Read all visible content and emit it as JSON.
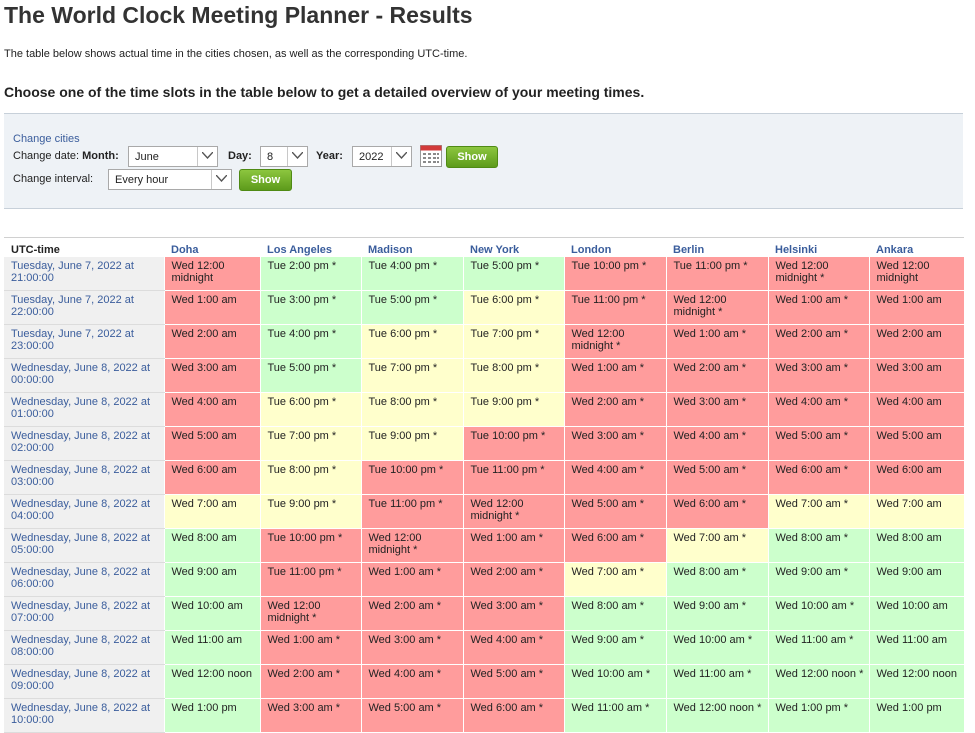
{
  "page": {
    "title": "The World Clock Meeting Planner - Results",
    "intro": "The table below shows actual time in the cities chosen, as well as the corresponding UTC-time.",
    "choose": "Choose one of the time slots in the table below to get a detailed overview of your meeting times."
  },
  "controls": {
    "change_cities": "Change cities",
    "change_date_label": "Change date:",
    "month_label": "Month:",
    "month_value": "June",
    "day_label": "Day:",
    "day_value": "8",
    "year_label": "Year:",
    "year_value": "2022",
    "show_label": "Show",
    "interval_label": "Change interval:",
    "interval_value": "Every hour",
    "show2_label": "Show",
    "calendar_icon": "calendar-icon"
  },
  "table": {
    "headers": [
      "UTC-time",
      "Doha",
      "Los Angeles",
      "Madison",
      "New York",
      "London",
      "Berlin",
      "Helsinki",
      "Ankara"
    ],
    "rows": [
      {
        "utc": "Tuesday, June 7, 2022 at 21:00:00",
        "cells": [
          [
            "Wed 12:00 midnight",
            "r"
          ],
          [
            "Tue 2:00 pm *",
            "g"
          ],
          [
            "Tue 4:00 pm *",
            "g"
          ],
          [
            "Tue 5:00 pm *",
            "g"
          ],
          [
            "Tue 10:00 pm *",
            "r"
          ],
          [
            "Tue 11:00 pm *",
            "r"
          ],
          [
            "Wed 12:00 midnight *",
            "r"
          ],
          [
            "Wed 12:00 midnight",
            "r"
          ]
        ]
      },
      {
        "utc": "Tuesday, June 7, 2022 at 22:00:00",
        "cells": [
          [
            "Wed 1:00 am",
            "r"
          ],
          [
            "Tue 3:00 pm *",
            "g"
          ],
          [
            "Tue 5:00 pm *",
            "g"
          ],
          [
            "Tue 6:00 pm *",
            "y"
          ],
          [
            "Tue 11:00 pm *",
            "r"
          ],
          [
            "Wed 12:00 midnight *",
            "r"
          ],
          [
            "Wed 1:00 am *",
            "r"
          ],
          [
            "Wed 1:00 am",
            "r"
          ]
        ]
      },
      {
        "utc": "Tuesday, June 7, 2022 at 23:00:00",
        "cells": [
          [
            "Wed 2:00 am",
            "r"
          ],
          [
            "Tue 4:00 pm *",
            "g"
          ],
          [
            "Tue 6:00 pm *",
            "y"
          ],
          [
            "Tue 7:00 pm *",
            "y"
          ],
          [
            "Wed 12:00 midnight *",
            "r"
          ],
          [
            "Wed 1:00 am *",
            "r"
          ],
          [
            "Wed 2:00 am *",
            "r"
          ],
          [
            "Wed 2:00 am",
            "r"
          ]
        ]
      },
      {
        "utc": "Wednesday, June 8, 2022 at 00:00:00",
        "cells": [
          [
            "Wed 3:00 am",
            "r"
          ],
          [
            "Tue 5:00 pm *",
            "g"
          ],
          [
            "Tue 7:00 pm *",
            "y"
          ],
          [
            "Tue 8:00 pm *",
            "y"
          ],
          [
            "Wed 1:00 am *",
            "r"
          ],
          [
            "Wed 2:00 am *",
            "r"
          ],
          [
            "Wed 3:00 am *",
            "r"
          ],
          [
            "Wed 3:00 am",
            "r"
          ]
        ]
      },
      {
        "utc": "Wednesday, June 8, 2022 at 01:00:00",
        "cells": [
          [
            "Wed 4:00 am",
            "r"
          ],
          [
            "Tue 6:00 pm *",
            "y"
          ],
          [
            "Tue 8:00 pm *",
            "y"
          ],
          [
            "Tue 9:00 pm *",
            "y"
          ],
          [
            "Wed 2:00 am *",
            "r"
          ],
          [
            "Wed 3:00 am *",
            "r"
          ],
          [
            "Wed 4:00 am *",
            "r"
          ],
          [
            "Wed 4:00 am",
            "r"
          ]
        ]
      },
      {
        "utc": "Wednesday, June 8, 2022 at 02:00:00",
        "cells": [
          [
            "Wed 5:00 am",
            "r"
          ],
          [
            "Tue 7:00 pm *",
            "y"
          ],
          [
            "Tue 9:00 pm *",
            "y"
          ],
          [
            "Tue 10:00 pm *",
            "r"
          ],
          [
            "Wed 3:00 am *",
            "r"
          ],
          [
            "Wed 4:00 am *",
            "r"
          ],
          [
            "Wed 5:00 am *",
            "r"
          ],
          [
            "Wed 5:00 am",
            "r"
          ]
        ]
      },
      {
        "utc": "Wednesday, June 8, 2022 at 03:00:00",
        "cells": [
          [
            "Wed 6:00 am",
            "r"
          ],
          [
            "Tue 8:00 pm *",
            "y"
          ],
          [
            "Tue 10:00 pm *",
            "r"
          ],
          [
            "Tue 11:00 pm *",
            "r"
          ],
          [
            "Wed 4:00 am *",
            "r"
          ],
          [
            "Wed 5:00 am *",
            "r"
          ],
          [
            "Wed 6:00 am *",
            "r"
          ],
          [
            "Wed 6:00 am",
            "r"
          ]
        ]
      },
      {
        "utc": "Wednesday, June 8, 2022 at 04:00:00",
        "cells": [
          [
            "Wed 7:00 am",
            "y"
          ],
          [
            "Tue 9:00 pm *",
            "y"
          ],
          [
            "Tue 11:00 pm *",
            "r"
          ],
          [
            "Wed 12:00 midnight *",
            "r"
          ],
          [
            "Wed 5:00 am *",
            "r"
          ],
          [
            "Wed 6:00 am *",
            "r"
          ],
          [
            "Wed 7:00 am *",
            "y"
          ],
          [
            "Wed 7:00 am",
            "y"
          ]
        ]
      },
      {
        "utc": "Wednesday, June 8, 2022 at 05:00:00",
        "cells": [
          [
            "Wed 8:00 am",
            "g"
          ],
          [
            "Tue 10:00 pm *",
            "r"
          ],
          [
            "Wed 12:00 midnight *",
            "r"
          ],
          [
            "Wed 1:00 am *",
            "r"
          ],
          [
            "Wed 6:00 am *",
            "r"
          ],
          [
            "Wed 7:00 am *",
            "y"
          ],
          [
            "Wed 8:00 am *",
            "g"
          ],
          [
            "Wed 8:00 am",
            "g"
          ]
        ]
      },
      {
        "utc": "Wednesday, June 8, 2022 at 06:00:00",
        "cells": [
          [
            "Wed 9:00 am",
            "g"
          ],
          [
            "Tue 11:00 pm *",
            "r"
          ],
          [
            "Wed 1:00 am *",
            "r"
          ],
          [
            "Wed 2:00 am *",
            "r"
          ],
          [
            "Wed 7:00 am *",
            "y"
          ],
          [
            "Wed 8:00 am *",
            "g"
          ],
          [
            "Wed 9:00 am *",
            "g"
          ],
          [
            "Wed 9:00 am",
            "g"
          ]
        ]
      },
      {
        "utc": "Wednesday, June 8, 2022 at 07:00:00",
        "cells": [
          [
            "Wed 10:00 am",
            "g"
          ],
          [
            "Wed 12:00 midnight *",
            "r"
          ],
          [
            "Wed 2:00 am *",
            "r"
          ],
          [
            "Wed 3:00 am *",
            "r"
          ],
          [
            "Wed 8:00 am *",
            "g"
          ],
          [
            "Wed 9:00 am *",
            "g"
          ],
          [
            "Wed 10:00 am *",
            "g"
          ],
          [
            "Wed 10:00 am",
            "g"
          ]
        ]
      },
      {
        "utc": "Wednesday, June 8, 2022 at 08:00:00",
        "cells": [
          [
            "Wed 11:00 am",
            "g"
          ],
          [
            "Wed 1:00 am *",
            "r"
          ],
          [
            "Wed 3:00 am *",
            "r"
          ],
          [
            "Wed 4:00 am *",
            "r"
          ],
          [
            "Wed 9:00 am *",
            "g"
          ],
          [
            "Wed 10:00 am *",
            "g"
          ],
          [
            "Wed 11:00 am *",
            "g"
          ],
          [
            "Wed 11:00 am",
            "g"
          ]
        ]
      },
      {
        "utc": "Wednesday, June 8, 2022 at 09:00:00",
        "cells": [
          [
            "Wed 12:00 noon",
            "g"
          ],
          [
            "Wed 2:00 am *",
            "r"
          ],
          [
            "Wed 4:00 am *",
            "r"
          ],
          [
            "Wed 5:00 am *",
            "r"
          ],
          [
            "Wed 10:00 am *",
            "g"
          ],
          [
            "Wed 11:00 am *",
            "g"
          ],
          [
            "Wed 12:00 noon *",
            "g"
          ],
          [
            "Wed 12:00 noon",
            "g"
          ]
        ]
      },
      {
        "utc": "Wednesday, June 8, 2022 at 10:00:00",
        "cells": [
          [
            "Wed 1:00 pm",
            "g"
          ],
          [
            "Wed 3:00 am *",
            "r"
          ],
          [
            "Wed 5:00 am *",
            "r"
          ],
          [
            "Wed 6:00 am *",
            "r"
          ],
          [
            "Wed 11:00 am *",
            "g"
          ],
          [
            "Wed 12:00 noon *",
            "g"
          ],
          [
            "Wed 1:00 pm *",
            "g"
          ],
          [
            "Wed 1:00 pm",
            "g"
          ]
        ]
      }
    ]
  }
}
